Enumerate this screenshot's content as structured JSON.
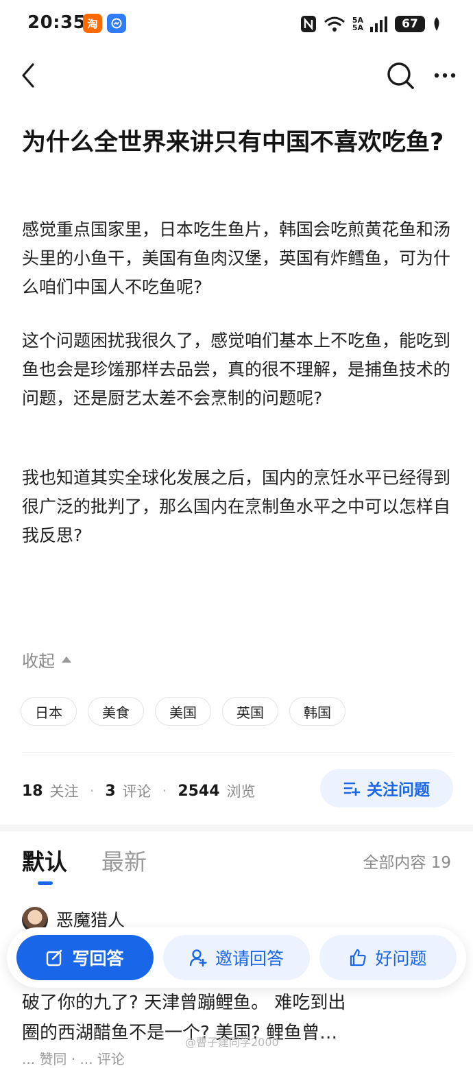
{
  "status_bar": {
    "time": "20:35",
    "app_icons": [
      "taobao-icon",
      "browser-icon"
    ],
    "signal_label_top": "5A",
    "signal_label_bottom": "5A",
    "battery": "67"
  },
  "nav": {
    "back_icon": "chevron-left-icon",
    "search_icon": "search-icon",
    "more_icon": "more-icon"
  },
  "question": {
    "title": "为什么全世界来讲只有中国不喜欢吃鱼?",
    "paragraphs": [
      "感觉重点国家里，日本吃生鱼片，韩国会吃煎黄花鱼和汤头里的小鱼干，美国有鱼肉汉堡，英国有炸鳕鱼，可为什么咱们中国人不吃鱼呢?",
      "这个问题困扰我很久了，感觉咱们基本上不吃鱼，能吃到鱼也会是珍馐那样去品尝，真的很不理解，是捕鱼技术的问题，还是厨艺太差不会烹制的问题呢?",
      "我也知道其实全球化发展之后，国内的烹饪水平已经得到很广泛的批判了，那么国内在烹制鱼水平之中可以怎样自我反思?"
    ],
    "collapse_label": "收起"
  },
  "tags": [
    "日本",
    "美食",
    "美国",
    "英国",
    "韩国"
  ],
  "stats": {
    "followers": "18",
    "followers_label": "关注",
    "comments": "3",
    "comments_label": "评论",
    "views": "2544",
    "views_label": "浏览"
  },
  "follow_button": "关注问题",
  "answers_header": {
    "tab_default": "默认",
    "tab_newest": "最新",
    "all_content": "全部内容 19"
  },
  "answer": {
    "author": "恶魔猎人",
    "excerpt_line1": "破了你的九了? 天津曾蹦鲤鱼。 难吃到出",
    "excerpt_line2": "圈的西湖醋鱼不是一个? 美国? 鲤鱼曾…",
    "meta": "... 赞同 · ... 评论"
  },
  "bottom_actions": {
    "write": "写回答",
    "invite": "邀请回答",
    "good": "好问题"
  },
  "watermark": "@曹子建同学2000",
  "colors": {
    "accent": "#1a66e8",
    "accent_light": "#edf3fe"
  }
}
